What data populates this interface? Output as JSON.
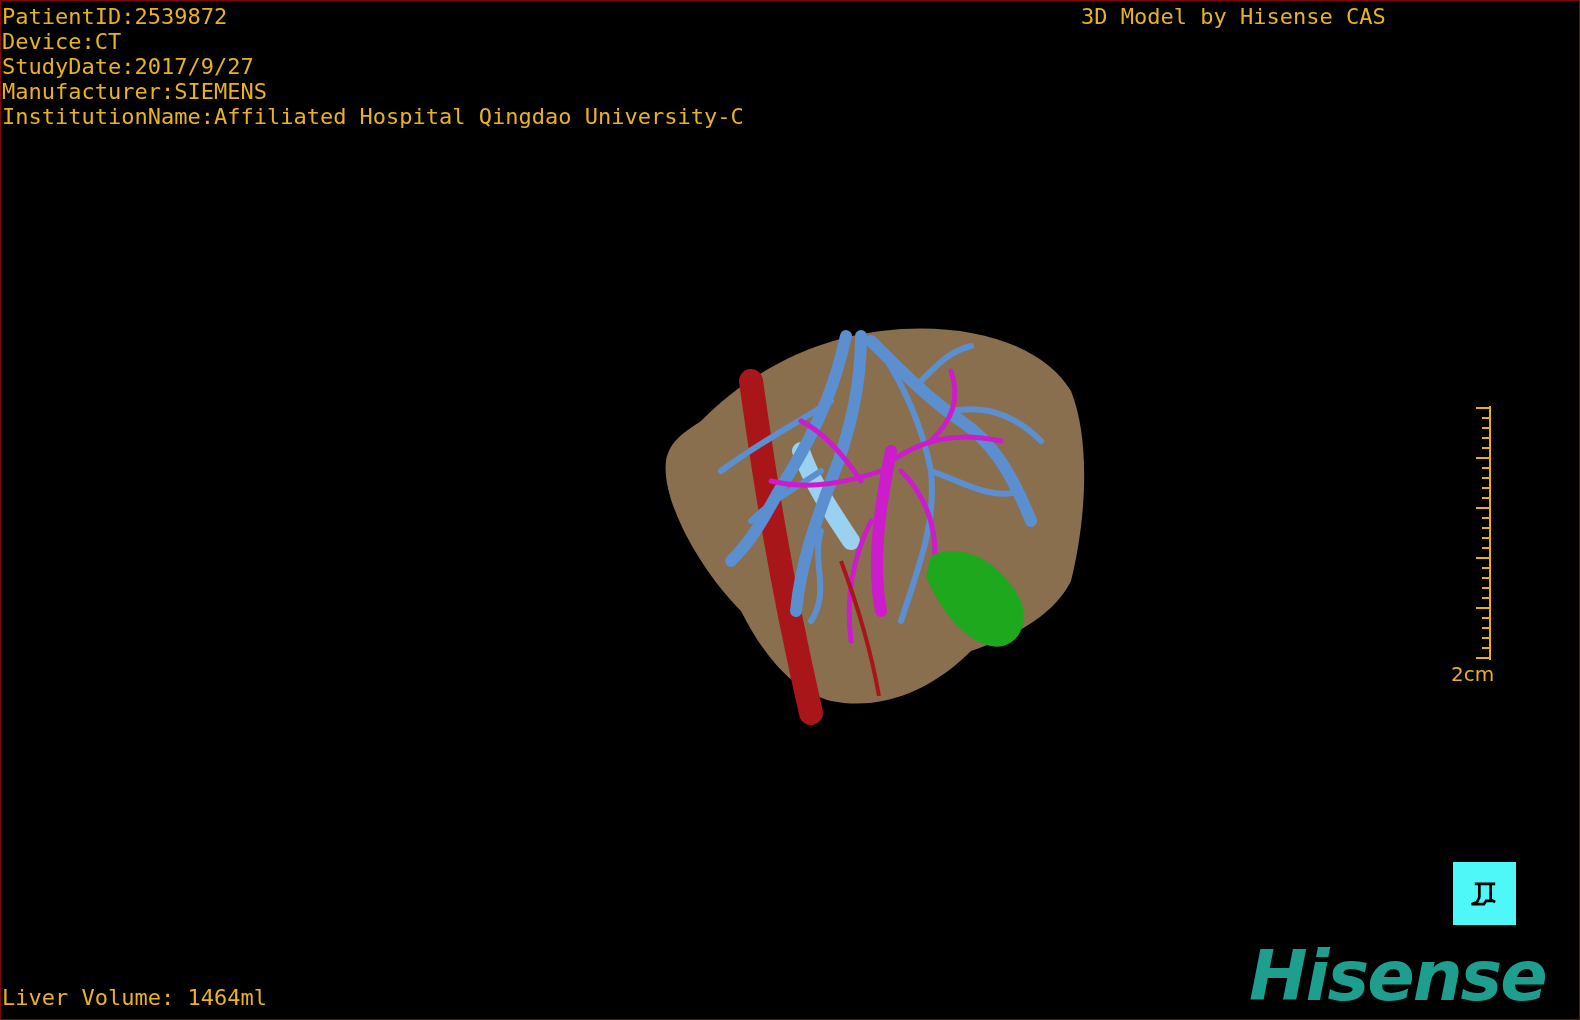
{
  "info_lines": [
    "PatientID:2539872",
    "Device:CT",
    "StudyDate:2017/9/27",
    "Manufacturer:SIEMENS",
    "InstitutionName:Affiliated Hospital Qingdao University-C"
  ],
  "title": "3D Model by Hisense CAS",
  "scale_bar": {
    "label": "2cm"
  },
  "liver_volume": "Liver Volume: 1464ml",
  "logo": "Hisense"
}
